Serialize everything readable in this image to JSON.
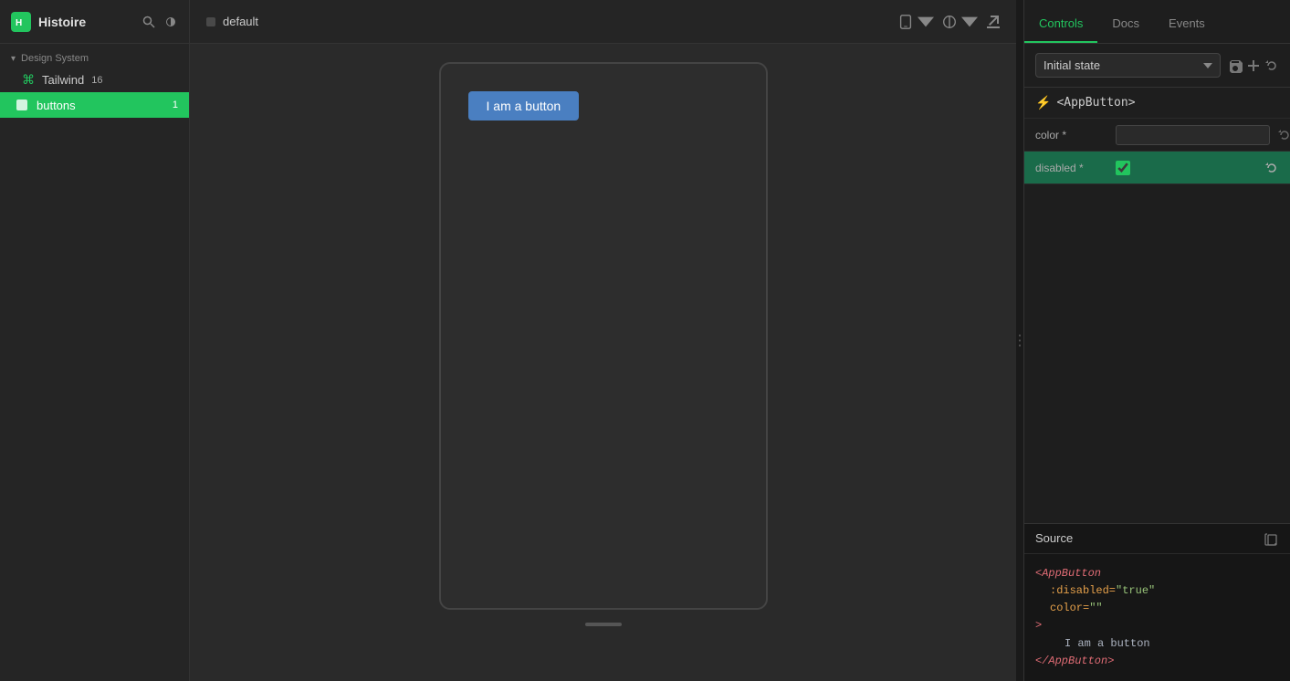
{
  "app": {
    "title": "Histoire",
    "logo_char": "H"
  },
  "sidebar": {
    "search_icon": "search-icon",
    "theme_icon": "theme-icon",
    "design_system_label": "Design System",
    "items": [
      {
        "id": "tailwind",
        "label": "Tailwind",
        "badge": "16",
        "icon": "layers-icon"
      },
      {
        "id": "buttons",
        "label": "buttons",
        "badge": "1",
        "icon": "box-icon",
        "active": true
      }
    ]
  },
  "toolbar": {
    "tab_label": "default",
    "device_label": "Device",
    "theme_label": "Theme"
  },
  "preview": {
    "button_label": "I am a button"
  },
  "right_panel": {
    "tabs": [
      {
        "id": "controls",
        "label": "Controls",
        "active": true
      },
      {
        "id": "docs",
        "label": "Docs",
        "active": false
      },
      {
        "id": "events",
        "label": "Events",
        "active": false
      }
    ],
    "state_selector": {
      "value": "Initial state",
      "options": [
        "Initial state"
      ]
    },
    "component_name": "<AppButton>",
    "props": [
      {
        "id": "color",
        "label": "color *",
        "type": "text",
        "value": "",
        "placeholder": ""
      },
      {
        "id": "disabled",
        "label": "disabled *",
        "type": "checkbox",
        "value": true
      }
    ]
  },
  "source": {
    "label": "Source",
    "code_lines": [
      {
        "type": "open-tag",
        "tag": "AppButton",
        "indent": 0
      },
      {
        "type": "attr-line",
        "attr": ":disabled",
        "value": "\"true\"",
        "indent": 1
      },
      {
        "type": "attr-line",
        "attr": "color",
        "value": "\"\"",
        "indent": 1
      },
      {
        "type": "close-start",
        "indent": 0
      },
      {
        "type": "text-content",
        "text": "I am a button",
        "indent": 2
      },
      {
        "type": "close-tag",
        "tag": "AppButton",
        "indent": 0
      }
    ]
  }
}
